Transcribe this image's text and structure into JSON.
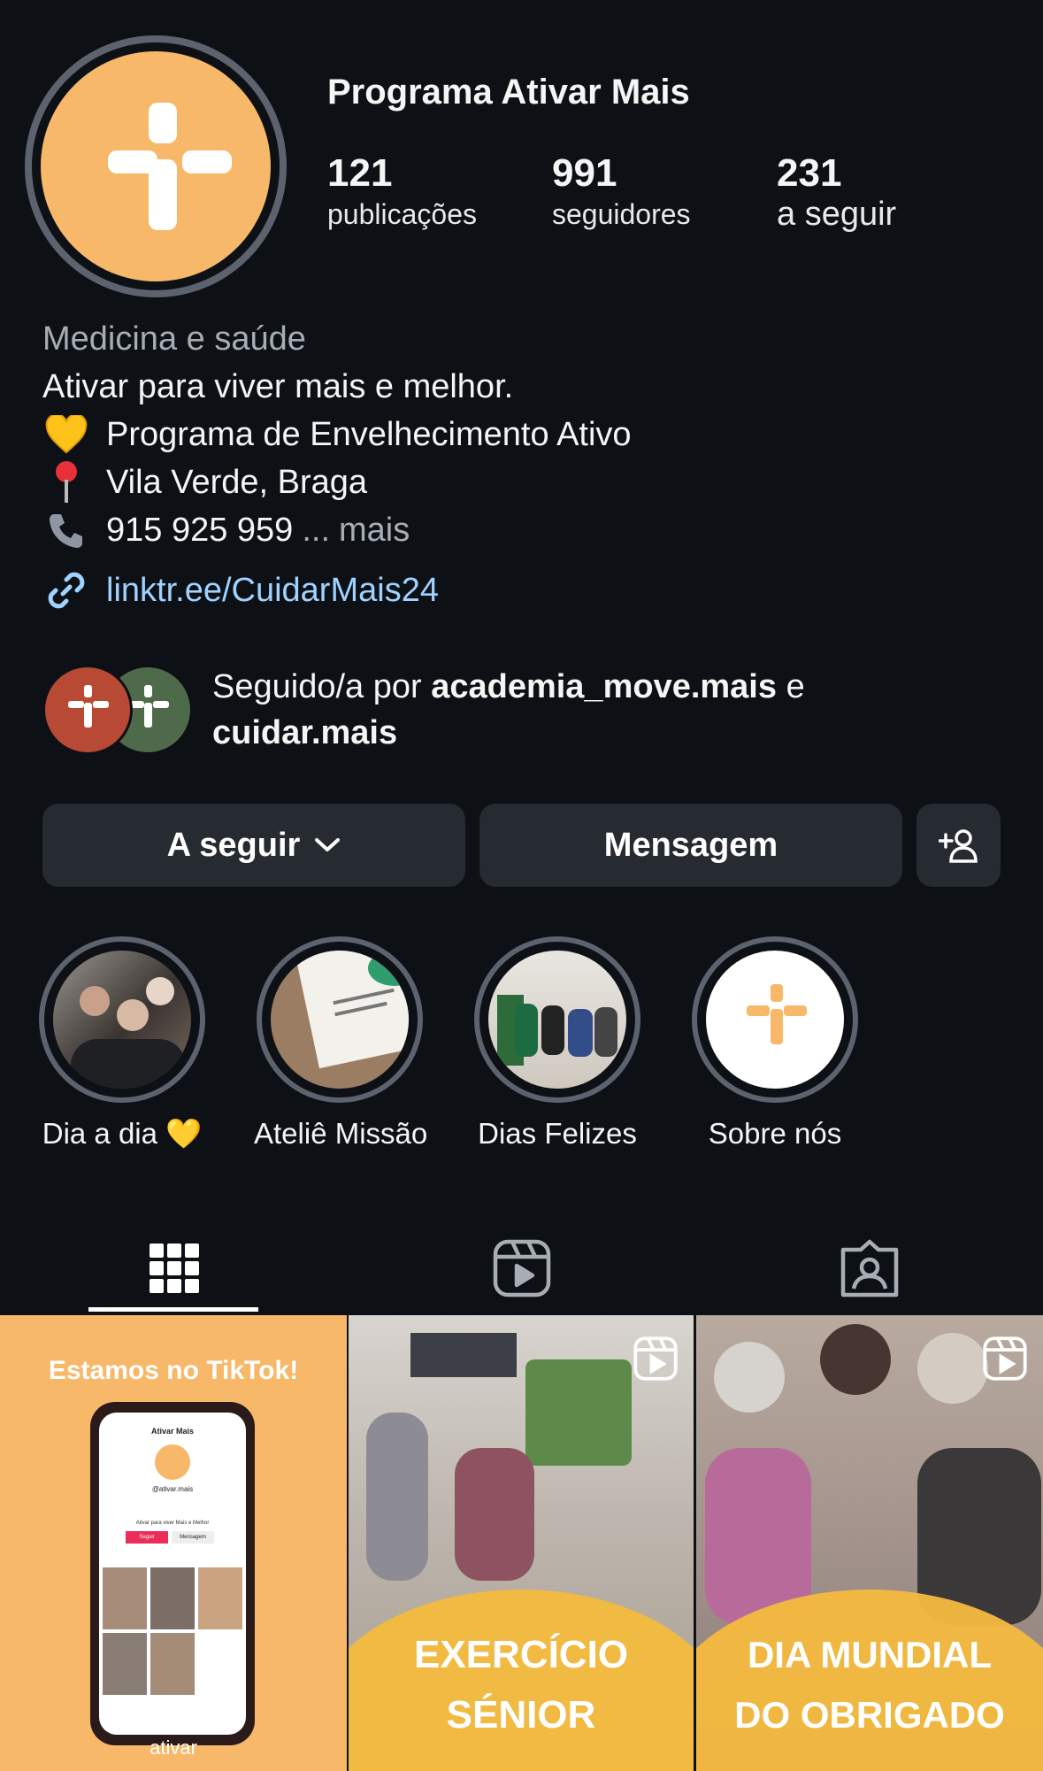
{
  "profile": {
    "name": "Programa Ativar Mais",
    "stats": [
      {
        "num": "121",
        "label": "publicações"
      },
      {
        "num": "991",
        "label": "seguidores"
      },
      {
        "num": "231",
        "label": "a seguir"
      }
    ]
  },
  "bio": {
    "category": "Medicina e saúde",
    "tagline": "Ativar para viver mais e melhor.",
    "program": "Programa de Envelhecimento Ativo",
    "location": "Vila Verde, Braga",
    "phone": "915 925 959",
    "ellipsis": "...",
    "more": "mais",
    "link": "linktr.ee/CuidarMais24"
  },
  "followed": {
    "prefix": "Seguido/a por",
    "user1": "academia_move.mais",
    "conj": "e",
    "user2": "cuidar.mais"
  },
  "buttons": {
    "following": "A seguir",
    "message": "Mensagem"
  },
  "highlights": [
    {
      "label": "Dia a dia 💛"
    },
    {
      "label": "Ateliê Missão"
    },
    {
      "label": "Dias Felizes"
    },
    {
      "label": "Sobre nós"
    }
  ],
  "posts": [
    {
      "title": "Estamos no TikTok!",
      "phone_header": "Ativar Mais",
      "phone_handle": "@ativar.mais",
      "phone_bio": "Ativar para viver Mais e Melhor",
      "phone_follow": "Seguir",
      "phone_message": "Mensagem",
      "footer": "ativar"
    },
    {
      "line1": "EXERCÍCIO",
      "line2": "SÉNIOR"
    },
    {
      "line1": "DIA MUNDIAL",
      "line2": "DO OBRIGADO"
    }
  ],
  "colors": {
    "background": "#0d1015",
    "brand_orange": "#f7b869",
    "button_bg": "#262a31",
    "link": "#9fd2ff"
  },
  "icons": [
    "logo-plus-icon",
    "heart-icon",
    "pin-icon",
    "phone-icon",
    "link-icon",
    "chevron-down-icon",
    "add-person-icon",
    "grid-icon",
    "reels-icon",
    "tagged-icon"
  ]
}
